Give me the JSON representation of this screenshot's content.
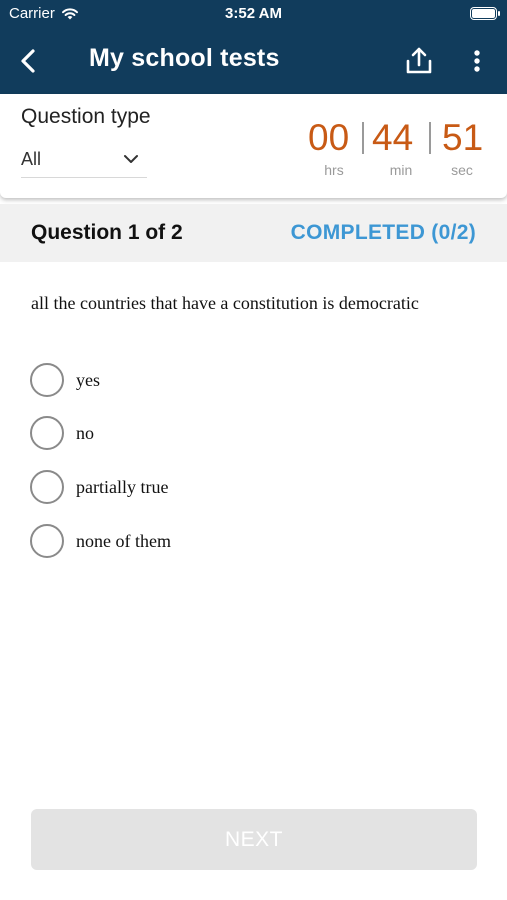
{
  "status_bar": {
    "carrier": "Carrier",
    "time": "3:52 AM",
    "icons": [
      "wifi-icon",
      "battery-icon"
    ]
  },
  "nav": {
    "title": "My school tests",
    "icons": [
      "back-icon",
      "share-icon",
      "more-vertical-icon"
    ]
  },
  "filter": {
    "label": "Question type",
    "selected": "All"
  },
  "timer": {
    "hours": "00",
    "minutes": "44",
    "seconds": "51",
    "hours_unit": "hrs",
    "minutes_unit": "min",
    "seconds_unit": "sec"
  },
  "question_header": {
    "count": "Question 1 of 2",
    "completed": "COMPLETED (0/2)"
  },
  "question": {
    "text": "all the countries that have a constitution is democratic",
    "options": [
      {
        "label": "yes",
        "selected": false
      },
      {
        "label": "no",
        "selected": false
      },
      {
        "label": "partially true",
        "selected": false
      },
      {
        "label": "none of them",
        "selected": false
      }
    ]
  },
  "next_button": {
    "label": "NEXT",
    "enabled": false
  },
  "colors": {
    "header_bg": "#113c5c",
    "timer_accent": "#c85a15",
    "completed_accent": "#3d97d4",
    "disabled_button": "#e3e3e3"
  }
}
